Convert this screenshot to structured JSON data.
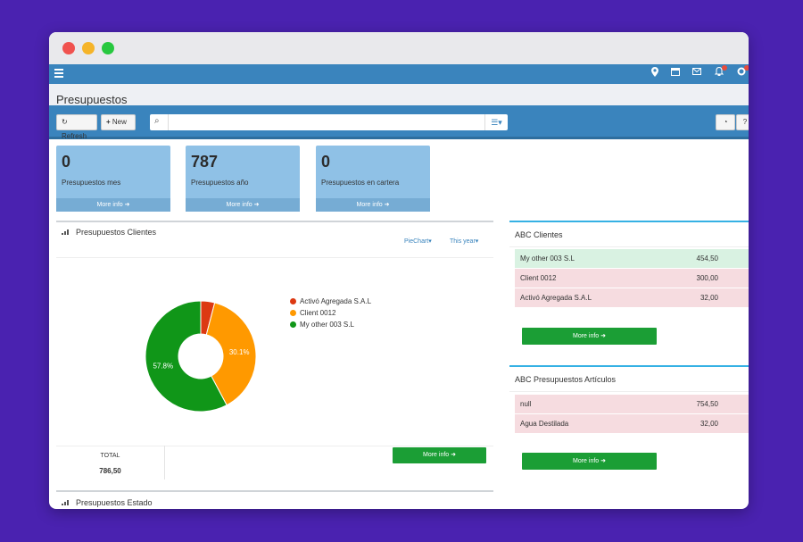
{
  "header": {
    "page_title": "Presupuestos"
  },
  "toolbar": {
    "refresh_label": "Refresh",
    "new_label": "New",
    "search_placeholder": ""
  },
  "stats": [
    {
      "value": "0",
      "label": "Presupuestos mes",
      "more": "More info"
    },
    {
      "value": "787",
      "label": "Presupuestos año",
      "more": "More info"
    },
    {
      "value": "0",
      "label": "Presupuestos en cartera",
      "more": "More info"
    }
  ],
  "clients_panel": {
    "title": "Presupuestos Clientes",
    "chart_type_label": "PieChart",
    "period_label": "This year",
    "total_label": "TOTAL",
    "total_value": "786,50",
    "more_info": "More info"
  },
  "chart_data": {
    "type": "pie",
    "title": "",
    "categories": [
      "Activó Agregada S.A.L",
      "Client 0012",
      "My other 003 S.L"
    ],
    "values": [
      32.0,
      300.0,
      454.5
    ],
    "labels": [
      "",
      "30.1%",
      "57.8%"
    ],
    "colors": [
      "#dc3912",
      "#ff9900",
      "#109618"
    ],
    "legend": "right"
  },
  "abc_clientes": {
    "title": "ABC Clientes",
    "rows": [
      {
        "name": "My other 003 S.L",
        "value": "454,50",
        "color": "#d9f2e2"
      },
      {
        "name": "Client 0012",
        "value": "300,00",
        "color": "#f6dce0"
      },
      {
        "name": "Activó Agregada S.A.L",
        "value": "32,00",
        "color": "#f6dce0"
      }
    ],
    "more_info": "More info"
  },
  "abc_articulos": {
    "title": "ABC Presupuestos Artículos",
    "rows": [
      {
        "name": "null",
        "value": "754,50",
        "color": "#f6dce0"
      },
      {
        "name": "Agua Destilada",
        "value": "32,00",
        "color": "#f6dce0"
      }
    ],
    "more_info": "More info"
  },
  "estado_panel": {
    "title": "Presupuestos Estado"
  },
  "icons": [
    "menu-icon",
    "location-icon",
    "calendar-icon",
    "mail-icon",
    "bell-icon",
    "settings-icon",
    "search-icon",
    "list-icon",
    "pie-icon",
    "help-icon",
    "refresh-icon",
    "plus-icon"
  ]
}
